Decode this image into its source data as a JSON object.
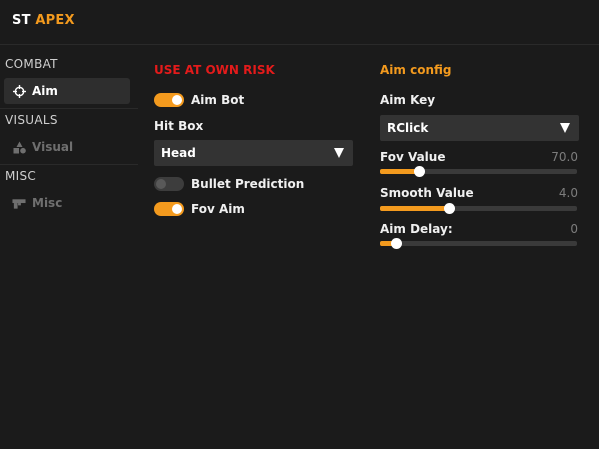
{
  "app": {
    "title_prefix": "ST",
    "title_accent": "APEX"
  },
  "sidebar": {
    "sections": [
      {
        "label": "COMBAT",
        "item": {
          "label": "Aim",
          "icon": "crosshair-icon",
          "active": true
        }
      },
      {
        "label": "VISUALS",
        "item": {
          "label": "Visual",
          "icon": "shapes-icon",
          "active": false
        }
      },
      {
        "label": "MISC",
        "item": {
          "label": "Misc",
          "icon": "gun-icon",
          "active": false
        }
      }
    ]
  },
  "left_panel": {
    "warning": "USE AT OWN RISK",
    "aim_bot": {
      "label": "Aim Bot",
      "on": true
    },
    "hit_box": {
      "label": "Hit Box",
      "value": "Head"
    },
    "bullet_prediction": {
      "label": "Bullet Prediction",
      "on": false
    },
    "fov_aim": {
      "label": "Fov Aim",
      "on": true
    }
  },
  "right_panel": {
    "title": "Aim config",
    "aim_key": {
      "label": "Aim Key",
      "value": "RClick"
    },
    "fov_value": {
      "label": "Fov Value",
      "value": "70.0",
      "fraction": 0.2
    },
    "smooth_value": {
      "label": "Smooth Value",
      "value": "4.0",
      "fraction": 0.35
    },
    "aim_delay": {
      "label": "Aim Delay:",
      "value": "0",
      "fraction": 0.08
    }
  },
  "colors": {
    "accent": "#f39a1e",
    "warning": "#e31b1b",
    "background": "#1b1b1b"
  }
}
